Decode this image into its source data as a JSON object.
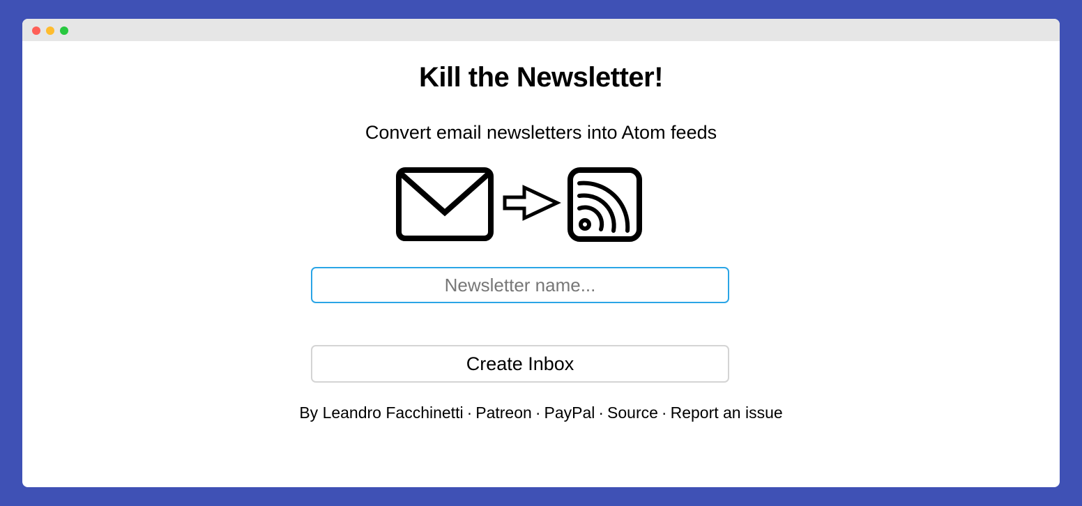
{
  "page": {
    "title": "Kill the Newsletter!",
    "subtitle": "Convert email newsletters into Atom feeds"
  },
  "illustration": {
    "icons": [
      "envelope-icon",
      "arrow-right-icon",
      "rss-feed-icon"
    ]
  },
  "form": {
    "name_input": {
      "value": "",
      "placeholder": "Newsletter name..."
    },
    "submit_label": "Create Inbox"
  },
  "footer": {
    "by_text": "By",
    "author": "Leandro Facchinetti",
    "separator": "·",
    "links": [
      "Patreon",
      "PayPal",
      "Source",
      "Report an issue"
    ]
  },
  "colors": {
    "background": "#3f51b5",
    "input_focus_border": "#2aa5e6",
    "titlebar": "#e6e6e6"
  }
}
